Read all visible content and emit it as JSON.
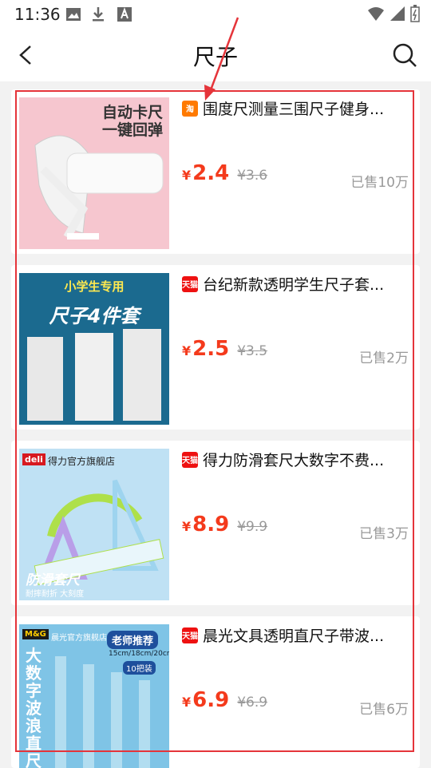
{
  "status": {
    "time": "11:36"
  },
  "header": {
    "title": "尺子"
  },
  "colors": {
    "accent": "#f43a1c",
    "frame": "#e5343a",
    "tmall": "#e11",
    "taobao": "#ff7a00"
  },
  "products": [
    {
      "badge": "淘",
      "badge_type": "taobao",
      "title": "围度尺测量三围尺子健身...",
      "currency": "¥",
      "price": "2.4",
      "orig_price": "¥3.6",
      "sold": "已售10万",
      "thumb": {
        "line1": "自动卡尺",
        "line2": "一键回弹"
      }
    },
    {
      "badge": "天猫",
      "badge_type": "tmall",
      "title": "台纪新款透明学生尺子套...",
      "currency": "¥",
      "price": "2.5",
      "orig_price": "¥3.5",
      "sold": "已售2万",
      "thumb": {
        "line1": "小学生专用",
        "line2": "尺子4件套"
      }
    },
    {
      "badge": "天猫",
      "badge_type": "tmall",
      "title": "得力防滑套尺大数字不费...",
      "currency": "¥",
      "price": "8.9",
      "orig_price": "¥9.9",
      "sold": "已售3万",
      "thumb": {
        "brand": "deli",
        "store": "得力官方旗舰店",
        "line1": "防滑套尺",
        "line2": "耐摔耐折 大刻度"
      }
    },
    {
      "badge": "天猫",
      "badge_type": "tmall",
      "title": "晨光文具透明直尺子带波...",
      "currency": "¥",
      "price": "6.9",
      "orig_price": "¥6.9",
      "sold": "已售6万",
      "thumb": {
        "brand": "M&G",
        "store": "晨光官方旗舰店",
        "line1": "老师推荐",
        "line2": "15cm/18cm/20cm",
        "line3": "10把装",
        "vertical": "大数字波浪直尺"
      }
    }
  ]
}
